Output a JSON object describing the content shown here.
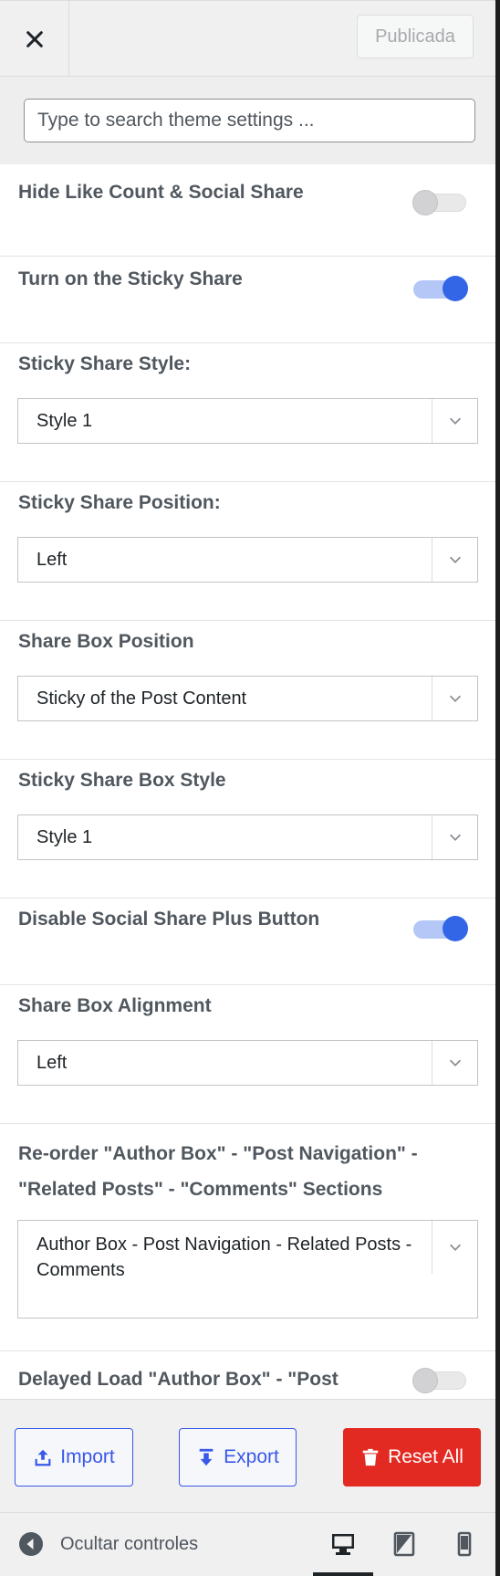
{
  "header": {
    "close_icon": "close-icon",
    "publish_label": "Publicada"
  },
  "search": {
    "placeholder": "Type to search theme settings ..."
  },
  "settings": {
    "hide_like_count": {
      "label": "Hide Like Count & Social Share",
      "enabled": false
    },
    "sticky_share": {
      "label": "Turn on the Sticky Share",
      "enabled": true
    },
    "sticky_share_style": {
      "label": "Sticky Share Style:",
      "value": "Style 1"
    },
    "sticky_share_position": {
      "label": "Sticky Share Position:",
      "value": "Left"
    },
    "share_box_position": {
      "label": "Share Box Position",
      "value": "Sticky of the Post Content"
    },
    "sticky_share_box_style": {
      "label": "Sticky Share Box Style",
      "value": "Style 1"
    },
    "disable_plus_button": {
      "label": "Disable Social Share Plus Button",
      "enabled": true
    },
    "share_box_alignment": {
      "label": "Share Box Alignment",
      "value": "Left"
    },
    "reorder_sections": {
      "label_line1": "Re-order \"Author Box\" - \"Post Navigation\" -",
      "label_line2": "\"Related Posts\" - \"Comments\" Sections",
      "value": "Author Box - Post Navigation - Related Posts - Comments"
    },
    "delayed_load": {
      "label": "Delayed Load \"Author Box\" - \"Post",
      "enabled": false
    }
  },
  "actions": {
    "import_label": "Import",
    "export_label": "Export",
    "reset_label": "Reset All"
  },
  "footer": {
    "hide_controls_label": "Ocultar controles",
    "devices": [
      "desktop-icon",
      "tablet-icon",
      "mobile-icon"
    ],
    "active_device": "desktop"
  },
  "colors": {
    "accent": "#3266e6",
    "link": "#3858e9",
    "danger": "#e32a22"
  }
}
